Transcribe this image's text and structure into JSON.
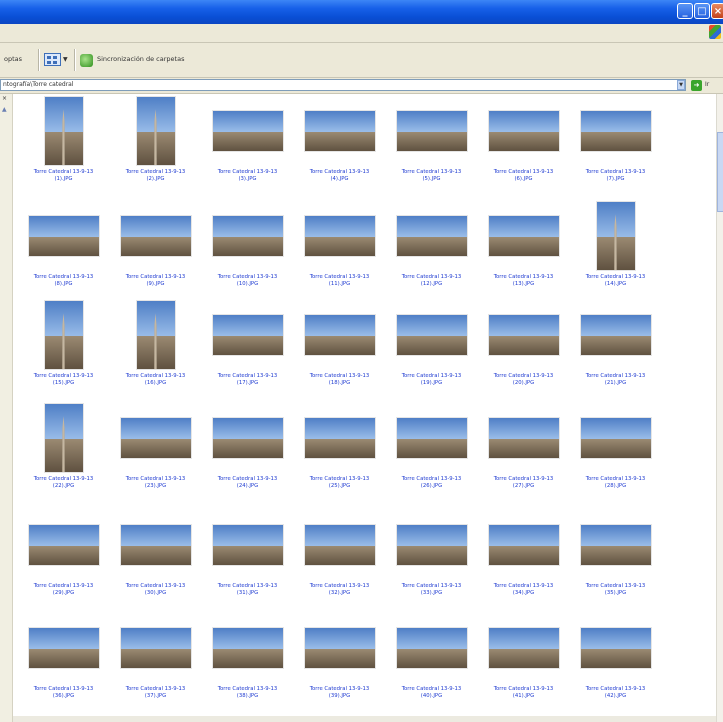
{
  "window": {
    "controls": [
      "minimize",
      "maximize",
      "close"
    ],
    "accent_color": "#0a4fd6"
  },
  "toolbar": {
    "partial_label": "optas",
    "sync_label": "Sincronización de carpetas"
  },
  "address": {
    "value": "ntografía\\Torre catedral",
    "go_label": "Ir"
  },
  "files": [
    {
      "name": "Torre Catedral 13-9-13",
      "num": "(1).JPG",
      "orientation": "portrait"
    },
    {
      "name": "Torre Catedral 13-9-13",
      "num": "(2).JPG",
      "orientation": "portrait"
    },
    {
      "name": "Torre Catedral 13-9-13",
      "num": "(3).JPG",
      "orientation": "landscape"
    },
    {
      "name": "Torre Catedral 13-9-13",
      "num": "(4).JPG",
      "orientation": "landscape"
    },
    {
      "name": "Torre Catedral 13-9-13",
      "num": "(5).JPG",
      "orientation": "landscape"
    },
    {
      "name": "Torre Catedral 13-9-13",
      "num": "(6).JPG",
      "orientation": "landscape"
    },
    {
      "name": "Torre Catedral 13-9-13",
      "num": "(7).JPG",
      "orientation": "landscape"
    },
    {
      "name": "Torre Catedral 13-9-13",
      "num": "(8).JPG",
      "orientation": "landscape"
    },
    {
      "name": "Torre Catedral 13-9-13",
      "num": "(9).JPG",
      "orientation": "landscape"
    },
    {
      "name": "Torre Catedral 13-9-13",
      "num": "(10).JPG",
      "orientation": "landscape"
    },
    {
      "name": "Torre Catedral 13-9-13",
      "num": "(11).JPG",
      "orientation": "landscape"
    },
    {
      "name": "Torre Catedral 13-9-13",
      "num": "(12).JPG",
      "orientation": "landscape"
    },
    {
      "name": "Torre Catedral 13-9-13",
      "num": "(13).JPG",
      "orientation": "landscape"
    },
    {
      "name": "Torre Catedral 13-9-13",
      "num": "(14).JPG",
      "orientation": "portrait"
    },
    {
      "name": "Torre Catedral 13-9-13",
      "num": "(15).JPG",
      "orientation": "portrait"
    },
    {
      "name": "Torre Catedral 13-9-13",
      "num": "(16).JPG",
      "orientation": "portrait"
    },
    {
      "name": "Torre Catedral 13-9-13",
      "num": "(17).JPG",
      "orientation": "landscape"
    },
    {
      "name": "Torre Catedral 13-9-13",
      "num": "(18).JPG",
      "orientation": "landscape"
    },
    {
      "name": "Torre Catedral 13-9-13",
      "num": "(19).JPG",
      "orientation": "landscape"
    },
    {
      "name": "Torre Catedral 13-9-13",
      "num": "(20).JPG",
      "orientation": "landscape"
    },
    {
      "name": "Torre Catedral 13-9-13",
      "num": "(21).JPG",
      "orientation": "landscape"
    },
    {
      "name": "Torre Catedral 13-9-13",
      "num": "(22).JPG",
      "orientation": "portrait"
    },
    {
      "name": "Torre Catedral 13-9-13",
      "num": "(23).JPG",
      "orientation": "landscape"
    },
    {
      "name": "Torre Catedral 13-9-13",
      "num": "(24).JPG",
      "orientation": "landscape"
    },
    {
      "name": "Torre Catedral 13-9-13",
      "num": "(25).JPG",
      "orientation": "landscape"
    },
    {
      "name": "Torre Catedral 13-9-13",
      "num": "(26).JPG",
      "orientation": "landscape"
    },
    {
      "name": "Torre Catedral 13-9-13",
      "num": "(27).JPG",
      "orientation": "landscape"
    },
    {
      "name": "Torre Catedral 13-9-13",
      "num": "(28).JPG",
      "orientation": "landscape"
    },
    {
      "name": "Torre Catedral 13-9-13",
      "num": "(29).JPG",
      "orientation": "landscape"
    },
    {
      "name": "Torre Catedral 13-9-13",
      "num": "(30).JPG",
      "orientation": "landscape"
    },
    {
      "name": "Torre Catedral 13-9-13",
      "num": "(31).JPG",
      "orientation": "landscape"
    },
    {
      "name": "Torre Catedral 13-9-13",
      "num": "(32).JPG",
      "orientation": "landscape"
    },
    {
      "name": "Torre Catedral 13-9-13",
      "num": "(33).JPG",
      "orientation": "landscape"
    },
    {
      "name": "Torre Catedral 13-9-13",
      "num": "(34).JPG",
      "orientation": "landscape"
    },
    {
      "name": "Torre Catedral 13-9-13",
      "num": "(35).JPG",
      "orientation": "landscape"
    },
    {
      "name": "Torre Catedral 13-9-13",
      "num": "(36).JPG",
      "orientation": "landscape"
    },
    {
      "name": "Torre Catedral 13-9-13",
      "num": "(37).JPG",
      "orientation": "landscape"
    },
    {
      "name": "Torre Catedral 13-9-13",
      "num": "(38).JPG",
      "orientation": "landscape"
    },
    {
      "name": "Torre Catedral 13-9-13",
      "num": "(39).JPG",
      "orientation": "landscape"
    },
    {
      "name": "Torre Catedral 13-9-13",
      "num": "(40).JPG",
      "orientation": "landscape"
    },
    {
      "name": "Torre Catedral 13-9-13",
      "num": "(41).JPG",
      "orientation": "landscape"
    },
    {
      "name": "Torre Catedral 13-9-13",
      "num": "(42).JPG",
      "orientation": "landscape"
    }
  ]
}
